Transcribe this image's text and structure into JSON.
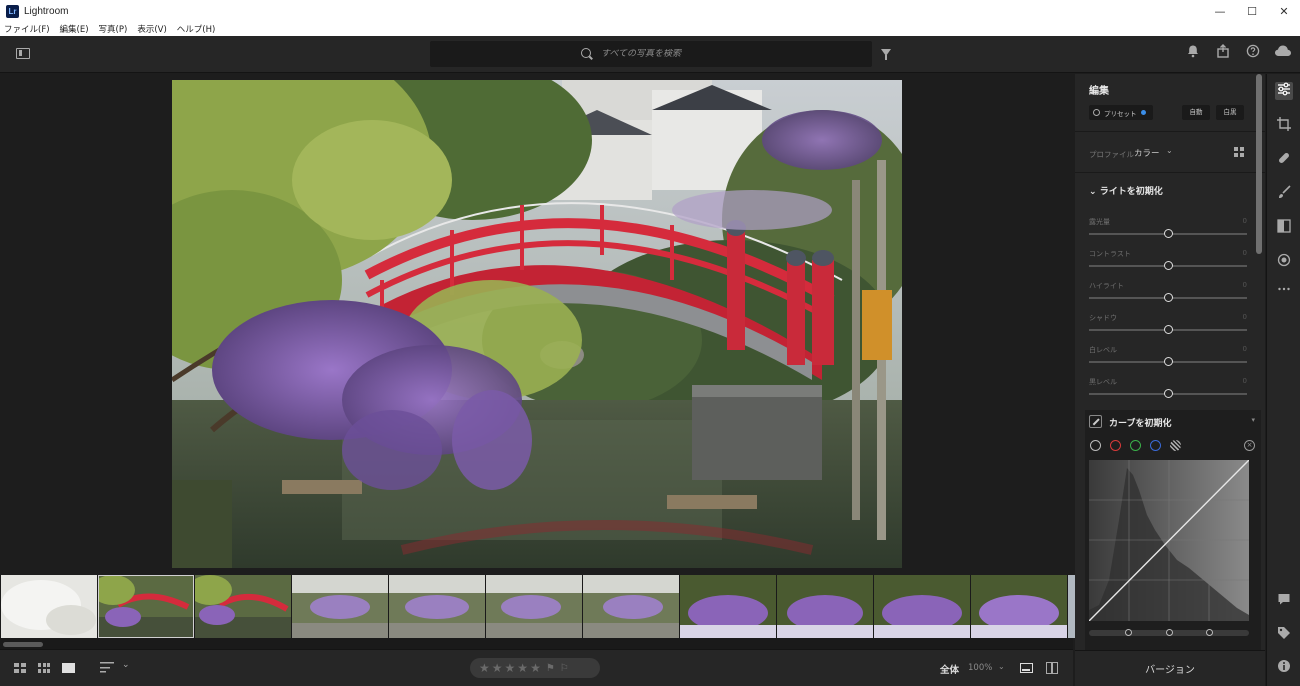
{
  "window": {
    "app_logo": "Lr",
    "title": "Lightroom",
    "minimize": "—",
    "maximize": "☐",
    "close": "✕"
  },
  "menu": [
    "ファイル(F)",
    "編集(E)",
    "写真(P)",
    "表示(V)",
    "ヘルプ(H)"
  ],
  "toolbar": {
    "search_placeholder": "すべての写真を検索"
  },
  "edit_panel": {
    "title": "編集",
    "preset_label": "プリセット",
    "auto_label": "自動",
    "bw_label": "白黒",
    "profile_label": "プロファイル",
    "profile_value": "カラー",
    "light_header": "ライトを初期化",
    "sliders": [
      {
        "label": "露光量",
        "value": "0",
        "position": 0.5
      },
      {
        "label": "コントラスト",
        "value": "0",
        "position": 0.5
      },
      {
        "label": "ハイライト",
        "value": "0",
        "position": 0.5
      },
      {
        "label": "シャドウ",
        "value": "0",
        "position": 0.5
      },
      {
        "label": "白レベル",
        "value": "0",
        "position": 0.5
      },
      {
        "label": "黒レベル",
        "value": "0",
        "position": 0.5
      }
    ],
    "curve_header": "カーブを初期化",
    "curve_dropdown": "▾",
    "channel_close": "×"
  },
  "bottombar": {
    "sort_chevron": "⌄",
    "zoom_label": "全体",
    "zoom_value": "100%",
    "zoom_chevron": "⌄"
  },
  "version_label": "バージョン",
  "rail_icons": [
    "edit-sliders-icon",
    "crop-icon",
    "healing-icon",
    "brush-icon",
    "linear-gradient-icon",
    "radial-gradient-icon",
    "more-icon",
    "comment-icon",
    "tag-icon",
    "info-icon"
  ],
  "colors": {
    "accent_blue": "#3b8ee8",
    "bridge_red": "#d52b3c",
    "wisteria_purple": "#8a64b8"
  }
}
